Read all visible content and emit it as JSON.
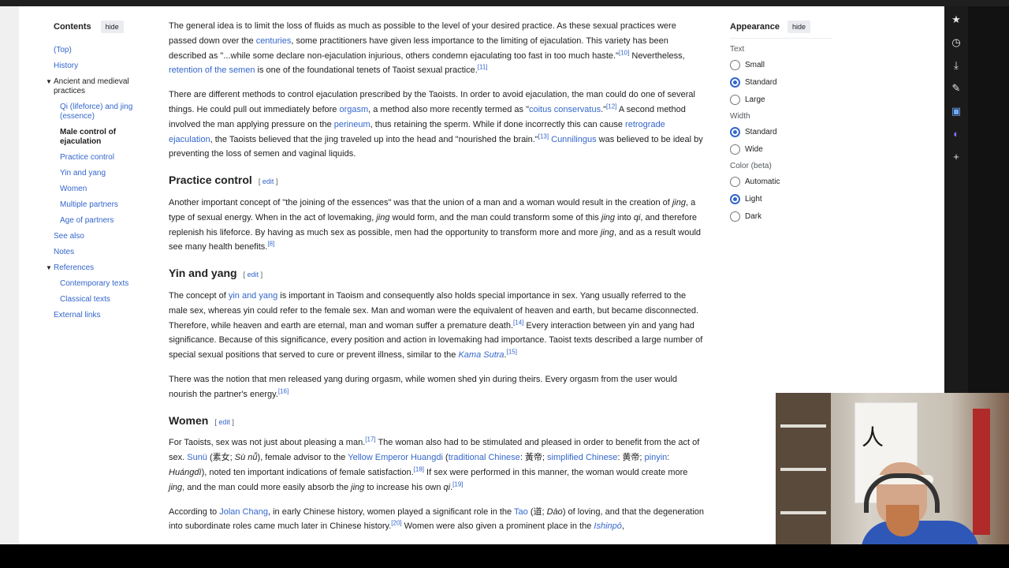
{
  "toc": {
    "title": "Contents",
    "hide_label": "hide",
    "items": [
      {
        "label": "(Top)"
      },
      {
        "label": "History"
      },
      {
        "label": "Ancient and medieval practices"
      },
      {
        "label": "Qi (lifeforce) and jing (essence)"
      },
      {
        "label": "Male control of ejaculation"
      },
      {
        "label": "Practice control"
      },
      {
        "label": "Yin and yang"
      },
      {
        "label": "Women"
      },
      {
        "label": "Multiple partners"
      },
      {
        "label": "Age of partners"
      },
      {
        "label": "See also"
      },
      {
        "label": "Notes"
      },
      {
        "label": "References"
      },
      {
        "label": "Contemporary texts"
      },
      {
        "label": "Classical texts"
      },
      {
        "label": "External links"
      }
    ]
  },
  "article": {
    "p1": {
      "t1": "The general idea is to limit the loss of fluids as much as possible to the level of your desired practice. As these sexual practices were passed down over the ",
      "l1": "centuries",
      "t2": ", some practitioners have given less importance to the limiting of ejaculation. This variety has been described as \"...while some declare non-ejaculation injurious, others condemn ejaculating too fast in too much haste.\"",
      "s1": "[10]",
      "t3": " Nevertheless, ",
      "l2": "retention of the semen",
      "t4": " is one of the foundational tenets of Taoist sexual practice.",
      "s2": "[11]"
    },
    "p2": {
      "t1": "There are different methods to control ejaculation prescribed by the Taoists. In order to avoid ejaculation, the man could do one of several things. He could pull out immediately before ",
      "l1": "orgasm",
      "t2": ", a method also more recently termed as \"",
      "l2": "coitus conservatus",
      "t3": ".\"",
      "s1": "[12]",
      "t4": " A second method involved the man applying pressure on the ",
      "l3": "perineum",
      "t5": ", thus retaining the sperm. While if done incorrectly this can cause ",
      "l4": "retrograde ejaculation",
      "t6": ", the Taoists believed that the jing traveled up into the head and \"nourished the brain.\"",
      "s2": "[13]",
      "t7": " ",
      "l5": "Cunnilingus",
      "t8": " was believed to be ideal by preventing the loss of semen and vaginal liquids."
    },
    "h_practice": "Practice control",
    "edit_label": "edit",
    "p3": {
      "t1": "Another important concept of \"the joining of the essences\" was that the union of a man and a woman would result in the creation of ",
      "e1": "jing",
      "t2": ", a type of sexual energy. When in the act of lovemaking, ",
      "e2": "jing",
      "t3": " would form, and the man could transform some of this ",
      "e3": "jing",
      "t4": " into ",
      "e4": "qi",
      "t5": ", and therefore replenish his lifeforce. By having as much sex as possible, men had the opportunity to transform more and more ",
      "e5": "jing",
      "t6": ", and as a result would see many health benefits.",
      "s1": "[8]"
    },
    "h_yinyang": "Yin and yang",
    "p4": {
      "t1": "The concept of ",
      "l1": "yin and yang",
      "t2": " is important in Taoism and consequently also holds special importance in sex. Yang usually referred to the male sex, whereas yin could refer to the female sex. Man and woman were the equivalent of heaven and earth, but became disconnected. Therefore, while heaven and earth are eternal, man and woman suffer a premature death.",
      "s1": "[14]",
      "t3": " Every interaction between yin and yang had significance. Because of this significance, every position and action in lovemaking had importance. Taoist texts described a large number of special sexual positions that served to cure or prevent illness, similar to the ",
      "l2": "Kama Sutra",
      "t4": ".",
      "s2": "[15]"
    },
    "p5": {
      "t1": "There was the notion that men released yang during orgasm, while women shed yin during theirs. Every orgasm from the user would nourish the partner's energy.",
      "s1": "[16]"
    },
    "h_women": "Women",
    "p6": {
      "t1": "For Taoists, sex was not just about pleasing a man.",
      "s1": "[17]",
      "t2": " The woman also had to be stimulated and pleased in order to benefit from the act of sex. ",
      "l1": "Sunü",
      "t3": " (素女; ",
      "e1": "Sù nǚ",
      "t4": "), female advisor to the ",
      "l2": "Yellow Emperor Huangdi",
      "t5": " (",
      "l3": "traditional Chinese",
      "t6": ": 黃帝; ",
      "l4": "simplified Chinese",
      "t7": ": 黄帝; ",
      "l5": "pinyin",
      "t8": ": ",
      "e2": "Huángdì",
      "t9": "), noted ten important indications of female satisfaction.",
      "s2": "[18]",
      "t10": " If sex were performed in this manner, the woman would create more ",
      "e3": "jing",
      "t11": ", and the man could more easily absorb the ",
      "e4": "jing",
      "t12": " to increase his own ",
      "e5": "qi",
      "t13": ".",
      "s3": "[19]"
    },
    "p7": {
      "t1": "According to ",
      "l1": "Jolan Chang",
      "t2": ", in early Chinese history, women played a significant role in the ",
      "l2": "Tao",
      "t3": " (道; ",
      "e1": "Dào",
      "t4": ") of loving, and that the degeneration into subordinate roles came much later in Chinese history.",
      "s1": "[20]",
      "t5": " Women were also given a prominent place in the ",
      "l3": "Ishinpō",
      "t6": ","
    }
  },
  "appearance": {
    "title": "Appearance",
    "hide_label": "hide",
    "text_label": "Text",
    "text_options": [
      "Small",
      "Standard",
      "Large"
    ],
    "width_label": "Width",
    "width_options": [
      "Standard",
      "Wide"
    ],
    "color_label": "Color (beta)",
    "color_options": [
      "Automatic",
      "Light",
      "Dark"
    ]
  },
  "sidebar_icons": [
    "star-icon",
    "history-icon",
    "download-icon",
    "pen-icon",
    "translate-icon",
    "extension-icon",
    "plus-icon"
  ],
  "colors": {
    "link": "#3366cc",
    "text": "#202122",
    "accent": "#3366cc"
  }
}
